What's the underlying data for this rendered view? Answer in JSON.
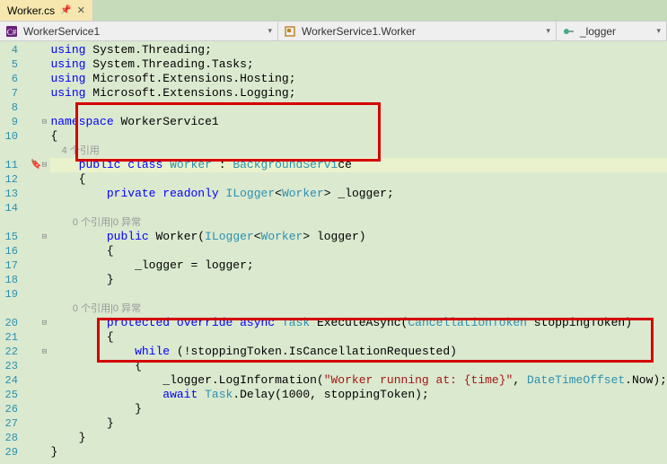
{
  "tab": {
    "filename": "Worker.cs"
  },
  "nav": {
    "scope1": "WorkerService1",
    "scope2": "WorkerService1.Worker",
    "scope3": "_logger"
  },
  "lines": {
    "4": {
      "tokens": [
        [
          "kw",
          "using"
        ],
        [
          "ident",
          " System.Threading;"
        ]
      ]
    },
    "5": {
      "tokens": [
        [
          "kw",
          "using"
        ],
        [
          "ident",
          " System.Threading.Tasks;"
        ]
      ]
    },
    "6": {
      "tokens": [
        [
          "kw",
          "using"
        ],
        [
          "ident",
          " Microsoft.Extensions.Hosting;"
        ]
      ]
    },
    "7": {
      "tokens": [
        [
          "kw",
          "using"
        ],
        [
          "ident",
          " Microsoft.Extensions.Logging;"
        ]
      ]
    },
    "8": {
      "tokens": []
    },
    "9": {
      "tokens": [
        [
          "kw",
          "namespace"
        ],
        [
          "ident",
          " WorkerService1"
        ]
      ]
    },
    "10": {
      "tokens": [
        [
          "ident",
          "{"
        ]
      ]
    },
    "cl1": {
      "text": "4 个引用",
      "indent": "    "
    },
    "11": {
      "tokens": [
        [
          "ident",
          "    "
        ],
        [
          "kw",
          "public class"
        ],
        [
          "ident",
          " "
        ],
        [
          "type",
          "Worker"
        ],
        [
          "ident",
          " : "
        ],
        [
          "type",
          "BackgroundServi"
        ],
        [
          "ident",
          "ce"
        ]
      ]
    },
    "12": {
      "tokens": [
        [
          "ident",
          "    {"
        ]
      ]
    },
    "13": {
      "tokens": [
        [
          "ident",
          "        "
        ],
        [
          "kw",
          "private readonly"
        ],
        [
          "ident",
          " "
        ],
        [
          "type",
          "ILogger"
        ],
        [
          "ident",
          "<"
        ],
        [
          "type",
          "Worker"
        ],
        [
          "ident",
          "> _logger;"
        ]
      ]
    },
    "14": {
      "tokens": []
    },
    "cl2": {
      "text": "0 个引用|0 异常",
      "indent": "        "
    },
    "15": {
      "tokens": [
        [
          "ident",
          "        "
        ],
        [
          "kw",
          "public"
        ],
        [
          "ident",
          " Worker("
        ],
        [
          "type",
          "ILogger"
        ],
        [
          "ident",
          "<"
        ],
        [
          "type",
          "Worker"
        ],
        [
          "ident",
          "> logger)"
        ]
      ]
    },
    "16": {
      "tokens": [
        [
          "ident",
          "        {"
        ]
      ]
    },
    "17": {
      "tokens": [
        [
          "ident",
          "            _logger = logger;"
        ]
      ]
    },
    "18": {
      "tokens": [
        [
          "ident",
          "        }"
        ]
      ]
    },
    "19": {
      "tokens": []
    },
    "cl3": {
      "text": "0 个引用|0 异常",
      "indent": "        "
    },
    "20": {
      "tokens": [
        [
          "ident",
          "        "
        ],
        [
          "kw",
          "protected override async"
        ],
        [
          "ident",
          " "
        ],
        [
          "type",
          "Task"
        ],
        [
          "ident",
          " ExecuteAsync("
        ],
        [
          "type",
          "CancellationToken"
        ],
        [
          "ident",
          " stoppingToken)"
        ]
      ]
    },
    "21": {
      "tokens": [
        [
          "ident",
          "        {"
        ]
      ]
    },
    "22": {
      "tokens": [
        [
          "ident",
          "            "
        ],
        [
          "kw",
          "while"
        ],
        [
          "ident",
          " (!stoppingToken.IsCancellationRequested)"
        ]
      ]
    },
    "23": {
      "tokens": [
        [
          "ident",
          "            {"
        ]
      ]
    },
    "24": {
      "tokens": [
        [
          "ident",
          "                _logger.LogInformation("
        ],
        [
          "str",
          "\"Worker running at: {time}\""
        ],
        [
          "ident",
          ", "
        ],
        [
          "type",
          "DateTimeOffset"
        ],
        [
          "ident",
          ".Now);"
        ]
      ]
    },
    "25": {
      "tokens": [
        [
          "ident",
          "                "
        ],
        [
          "kw",
          "await"
        ],
        [
          "ident",
          " "
        ],
        [
          "type",
          "Task"
        ],
        [
          "ident",
          ".Delay(1000, stoppingToken);"
        ]
      ]
    },
    "26": {
      "tokens": [
        [
          "ident",
          "            }"
        ]
      ]
    },
    "27": {
      "tokens": [
        [
          "ident",
          "        }"
        ]
      ]
    },
    "28": {
      "tokens": [
        [
          "ident",
          "    }"
        ]
      ]
    },
    "29": {
      "tokens": [
        [
          "ident",
          "}"
        ]
      ]
    }
  },
  "numbers": [
    "4",
    "5",
    "6",
    "7",
    "8",
    "9",
    "10",
    "",
    "11",
    "12",
    "13",
    "14",
    "",
    "15",
    "16",
    "17",
    "18",
    "19",
    "",
    "20",
    "21",
    "22",
    "23",
    "24",
    "25",
    "26",
    "27",
    "28",
    "29"
  ],
  "outline": [
    "",
    "",
    "",
    "",
    "",
    "-",
    "",
    "",
    "-",
    "",
    "",
    "",
    "",
    "-",
    "",
    "",
    "",
    "",
    "",
    "-",
    "",
    "-",
    "",
    "",
    "",
    "",
    "",
    "",
    ""
  ],
  "break": [
    "",
    "",
    "",
    "",
    "",
    "",
    "",
    "",
    "t",
    "",
    "",
    "",
    "",
    "",
    "",
    "",
    "",
    "",
    "",
    "",
    "",
    "",
    "",
    "",
    "",
    "",
    "",
    "",
    ""
  ]
}
